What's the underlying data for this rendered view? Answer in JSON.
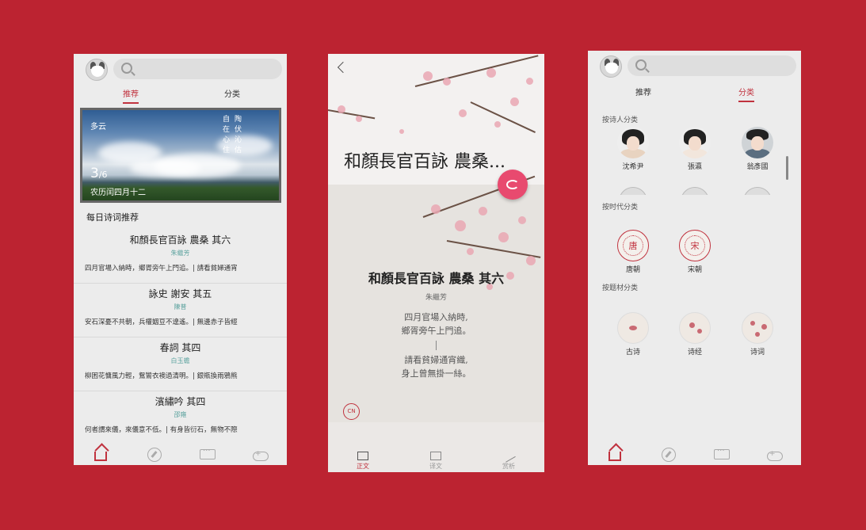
{
  "colors": {
    "background": "#bc2331",
    "accent": "#c0323e",
    "author": "#5fa4a0",
    "fab": "#e84a6f"
  },
  "screen1": {
    "tabs": [
      "推荐",
      "分类"
    ],
    "weather": {
      "condition": "多云",
      "poem_chars": [
        "自",
        "陶",
        "在",
        "伏",
        "心",
        "沁",
        "住",
        "估"
      ],
      "date_big": "3",
      "date_small": "/6",
      "lunar": "农历闰四月十二"
    },
    "daily_title": "每日诗词推荐",
    "poems": [
      {
        "title": "和顏長官百詠 農桑 其六",
        "author": "朱繼芳",
        "excerpt": "四月官場入納時，鄉胥旁午上門追。| 請看貧婦通宵"
      },
      {
        "title": "詠史 謝安 其五",
        "author": "陳普",
        "excerpt": "安石深憂不共朝，兵權姻豆不遑遙。| 無邊赤子皆經"
      },
      {
        "title": "春詞 其四",
        "author": "白玉蟾",
        "excerpt": "柳困花慵風力輕，鴛鸞衣襖過清明。| 銀瓶換雨鴉熊"
      },
      {
        "title": "濱繡吟 其四",
        "author": "邵雍",
        "excerpt": "何者謂來儀，來儀意不低。| 有身皆衍石，無物不際"
      }
    ],
    "nav": [
      "home-icon",
      "compass-icon",
      "chat-icon",
      "gamepad-icon"
    ]
  },
  "screen2": {
    "header_title": "和顏長官百詠 農桑...",
    "title": "和顏長官百詠 農桑 其六",
    "author": "朱繼芳",
    "lines": [
      "四月官場入納時,",
      "鄉胥旁午上門追。"
    ],
    "lines2": [
      "請看貧婦通宵織,",
      "身上曾無掛一絲。"
    ],
    "lang": "CN",
    "nav": [
      {
        "label": "正文",
        "icon": "book-icon"
      },
      {
        "label": "译文",
        "icon": "translation-icon"
      },
      {
        "label": "赏析",
        "icon": "edit-icon"
      }
    ]
  },
  "screen3": {
    "tabs": [
      "推荐",
      "分类"
    ],
    "by_poet": "按诗人分类",
    "poets": [
      "沈希尹",
      "張瀛",
      "翁彥國"
    ],
    "by_dynasty": "按时代分类",
    "dynasties": [
      {
        "seal": "唐",
        "name": "唐朝"
      },
      {
        "seal": "宋",
        "name": "宋朝"
      }
    ],
    "by_topic": "按题材分类",
    "topics": [
      "古诗",
      "诗经",
      "诗词"
    ]
  }
}
